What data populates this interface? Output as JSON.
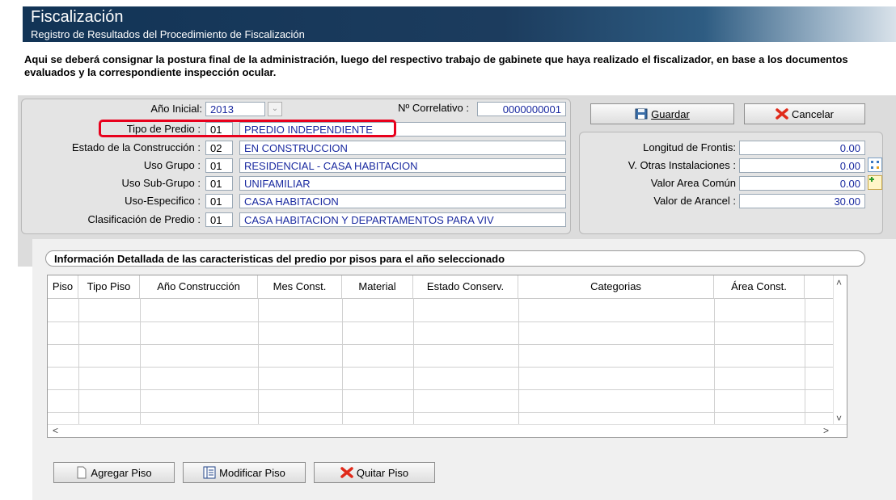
{
  "header": {
    "title": "Fiscalización",
    "subtitle": "Registro de Resultados del Procedimiento de Fiscalización"
  },
  "intro": "Aqui se deberá consignar la postura final de la administración, luego del respectivo trabajo de gabinete que haya realizado el fiscalizador, en base a los documentos evaluados y la correspondiente inspección ocular.",
  "form": {
    "anio_label": "Año Inicial:",
    "anio_value": "2013",
    "correlativo_label": "Nº Correlativo :",
    "correlativo_value": "0000000001",
    "rows": [
      {
        "label": "Tipo de Predio :",
        "code": "01",
        "desc": "PREDIO INDEPENDIENTE"
      },
      {
        "label": "Estado de la Construcción :",
        "code": "02",
        "desc": "EN CONSTRUCCION"
      },
      {
        "label": "Uso Grupo :",
        "code": "01",
        "desc": "RESIDENCIAL - CASA HABITACION"
      },
      {
        "label": "Uso Sub-Grupo :",
        "code": "01",
        "desc": "UNIFAMILIAR"
      },
      {
        "label": "Uso-Especifico :",
        "code": "01",
        "desc": "CASA HABITACION"
      },
      {
        "label": "Clasificación de Predio :",
        "code": "01",
        "desc": "CASA HABITACION Y DEPARTAMENTOS PARA VIV"
      }
    ]
  },
  "actions": {
    "guardar": "Guardar",
    "cancelar": "Cancelar"
  },
  "values": [
    {
      "label": "Longitud de Frontis:",
      "value": "0.00"
    },
    {
      "label": "V. Otras Instalaciones :",
      "value": "0.00"
    },
    {
      "label": "Valor Area Común",
      "value": "0.00"
    },
    {
      "label": "Valor de Arancel :",
      "value": "30.00"
    }
  ],
  "section_title": "Información Detallada de las caracteristicas del predio por pisos para el año seleccionado",
  "table": {
    "columns": [
      "Piso",
      "Tipo Piso",
      "Año Construcción",
      "Mes Const.",
      "Material",
      "Estado Conserv.",
      "Categorias",
      "Área Const.",
      ""
    ]
  },
  "bottom_buttons": {
    "agregar": "Agregar Piso",
    "modificar": "Modificar Piso",
    "quitar": "Quitar Piso"
  },
  "colors": {
    "header_bg": "#123456",
    "highlight": "#e8001c",
    "value_text": "#1a2aa0"
  }
}
